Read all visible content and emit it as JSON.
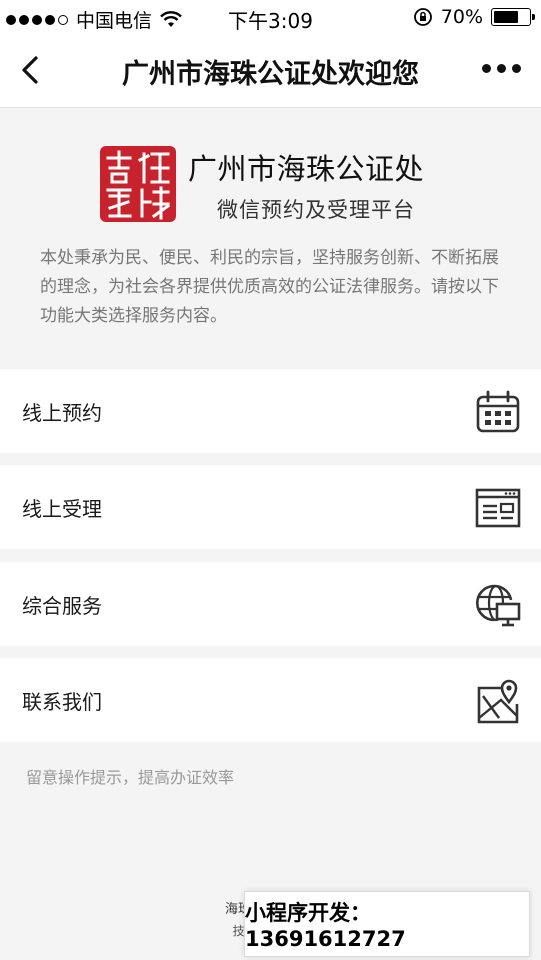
{
  "status_bar": {
    "carrier": "中国电信",
    "time": "下午3:09",
    "battery": "70%",
    "battery_level": 0.7
  },
  "nav": {
    "title": "广州市海珠公证处欢迎您"
  },
  "header": {
    "seal_text": "海珠公证",
    "org_name": "广州市海珠公证处",
    "org_subtitle": "微信预约及受理平台",
    "intro": "本处秉承为民、便民、利民的宗旨，坚持服务创新、不断拓展的理念，为社会各界提供优质高效的公证法律服务。请按以下功能大类选择服务内容。"
  },
  "menu": [
    {
      "label": "线上预约",
      "icon": "calendar-icon"
    },
    {
      "label": "线上受理",
      "icon": "browser-window-icon"
    },
    {
      "label": "综合服务",
      "icon": "globe-monitor-icon"
    },
    {
      "label": "联系我们",
      "icon": "map-pin-icon"
    }
  ],
  "hint": "留意操作提示，提高办证效率",
  "footer": {
    "line1": "海珠公证处微信",
    "line2": "技术支持 飞时"
  },
  "banner": {
    "text": "小程序开发：13691612727"
  },
  "colors": {
    "seal": "#c8232c",
    "background": "#f4f4f4",
    "text_muted": "#777777"
  }
}
